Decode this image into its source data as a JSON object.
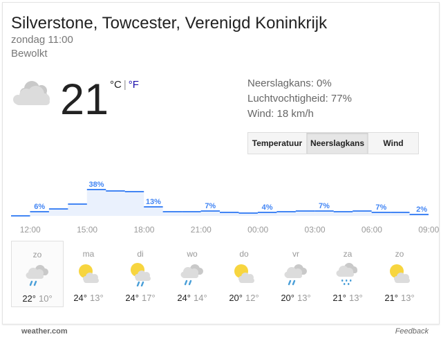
{
  "location": "Silverstone, Towcester, Verenigd Koninkrijk",
  "datetime": "zondag 11:00",
  "condition": "Bewolkt",
  "current": {
    "temp": "21",
    "unit_c": "°C",
    "unit_sep": "|",
    "unit_f": "°F",
    "icon": "cloudy-icon"
  },
  "details": {
    "precip": "Neerslagkans: 0%",
    "humidity": "Luchtvochtigheid: 77%",
    "wind": "Wind: 18 km/h"
  },
  "tabs": [
    {
      "label": "Temperatuur",
      "active": false
    },
    {
      "label": "Neerslagkans",
      "active": true
    },
    {
      "label": "Wind",
      "active": false
    }
  ],
  "chart_data": {
    "type": "area",
    "title": "",
    "xlabel": "",
    "ylabel": "",
    "x": [
      "12:00",
      "13:00",
      "14:00",
      "15:00",
      "16:00",
      "17:00",
      "18:00",
      "19:00",
      "20:00",
      "21:00",
      "22:00",
      "23:00",
      "00:00",
      "01:00",
      "02:00",
      "03:00",
      "04:00",
      "05:00",
      "06:00",
      "07:00",
      "08:00",
      "09:00"
    ],
    "tick_labels": [
      "12:00",
      "15:00",
      "18:00",
      "21:00",
      "00:00",
      "03:00",
      "06:00",
      "09:00"
    ],
    "values": [
      0,
      6,
      10,
      17,
      38,
      36,
      35,
      13,
      6,
      6,
      7,
      5,
      4,
      5,
      6,
      7,
      7,
      6,
      7,
      5,
      5,
      2
    ],
    "labels": [
      {
        "index": 1,
        "text": "6%"
      },
      {
        "index": 4,
        "text": "38%"
      },
      {
        "index": 7,
        "text": "13%"
      },
      {
        "index": 10,
        "text": "7%"
      },
      {
        "index": 13,
        "text": "4%"
      },
      {
        "index": 16,
        "text": "7%"
      },
      {
        "index": 19,
        "text": "7%"
      },
      {
        "index": 21,
        "text": "2%"
      }
    ],
    "ylim": [
      0,
      100
    ],
    "line_color": "#4285f4",
    "fill_color": "#eaf1fd",
    "label_color": "#4285f4"
  },
  "forecast": [
    {
      "day": "zo",
      "hi": "22°",
      "lo": "10°",
      "icon": "cloud-rain-icon",
      "active": true
    },
    {
      "day": "ma",
      "hi": "24°",
      "lo": "13°",
      "icon": "partly-cloudy-icon",
      "active": false
    },
    {
      "day": "di",
      "hi": "24°",
      "lo": "17°",
      "icon": "partly-cloudy-rain-icon",
      "active": false
    },
    {
      "day": "wo",
      "hi": "24°",
      "lo": "14°",
      "icon": "cloud-rain-icon",
      "active": false
    },
    {
      "day": "do",
      "hi": "20°",
      "lo": "12°",
      "icon": "partly-cloudy-icon",
      "active": false
    },
    {
      "day": "vr",
      "hi": "20°",
      "lo": "13°",
      "icon": "cloud-rain-icon",
      "active": false
    },
    {
      "day": "za",
      "hi": "21°",
      "lo": "13°",
      "icon": "showers-icon",
      "active": false
    },
    {
      "day": "zo",
      "hi": "21°",
      "lo": "13°",
      "icon": "partly-cloudy-icon",
      "active": false
    }
  ],
  "footer": {
    "source": "weather.com",
    "feedback": "Feedback"
  }
}
